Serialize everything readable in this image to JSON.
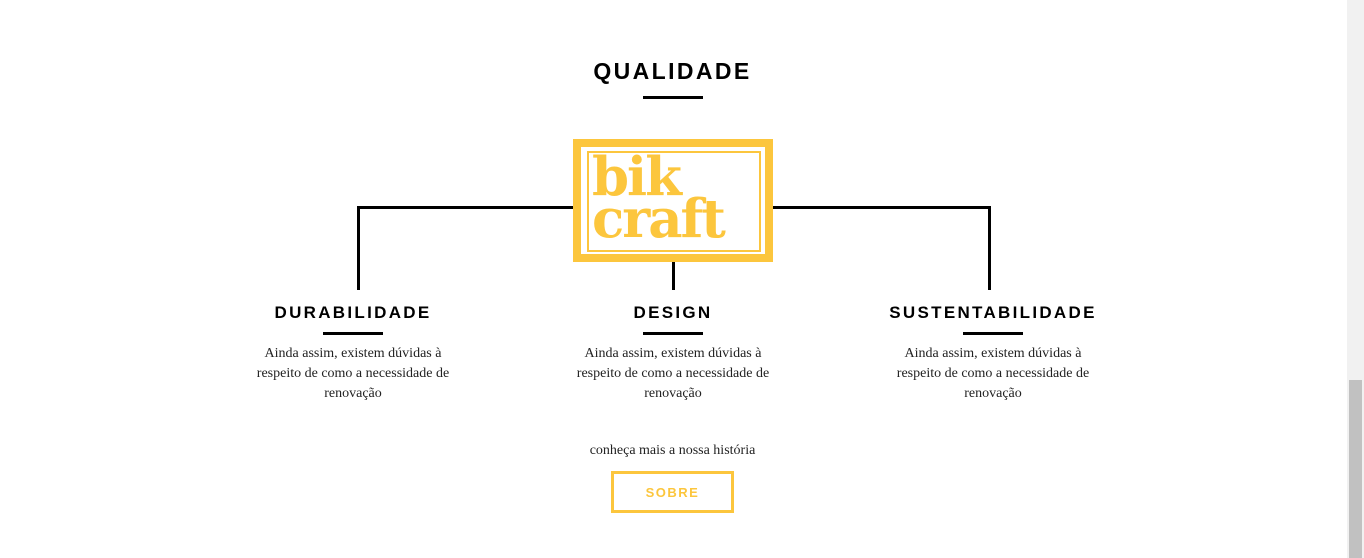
{
  "section": {
    "title": "QUALIDADE"
  },
  "logo": {
    "line1": "bik",
    "line2": "craft"
  },
  "features": [
    {
      "title": "DURABILIDADE",
      "text": "Ainda assim, existem dúvidas à respeito de como a necessidade de renovação"
    },
    {
      "title": "DESIGN",
      "text": "Ainda assim, existem dúvidas à respeito de como a necessidade de renovação"
    },
    {
      "title": "SUSTENTABILIDADE",
      "text": "Ainda assim, existem dúvidas à respeito de como a necessidade de renovação"
    }
  ],
  "cta": {
    "text": "conheça mais a nossa história",
    "button_label": "SOBRE"
  },
  "colors": {
    "accent": "#fcc63d",
    "text": "#000000",
    "background": "#ffffff"
  }
}
